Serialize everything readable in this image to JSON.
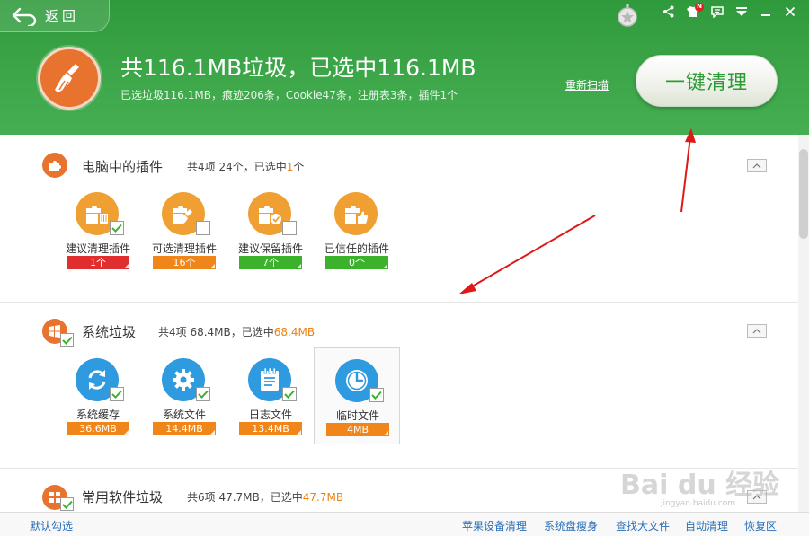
{
  "header": {
    "back_label": "返回",
    "summary_title": "共116.1MB垃圾，已选中116.1MB",
    "summary_sub": "已选垃圾116.1MB，痕迹206条，Cookie47条，注册表3条，插件1个",
    "rescan_label": "重新扫描",
    "clean_button_label": "一键清理",
    "badge": "N",
    "accent_color": "#3da74a"
  },
  "sections": [
    {
      "title": "电脑中的插件",
      "summary_prefix": "共4项 24个，已选中",
      "summary_highlight": "1",
      "summary_suffix": "个",
      "items": [
        {
          "label": "建议清理插件",
          "value": "1个",
          "color": "#e02e2e",
          "checked": true
        },
        {
          "label": "可选清理插件",
          "value": "16个",
          "color": "#f0861a",
          "checked": false
        },
        {
          "label": "建议保留插件",
          "value": "7个",
          "color": "#3cb22c",
          "checked": false
        },
        {
          "label": "已信任的插件",
          "value": "0个",
          "color": "#3cb22c",
          "checked": false
        }
      ]
    },
    {
      "title": "系统垃圾",
      "summary_prefix": "共4项 68.4MB，已选中",
      "summary_highlight": "68.4MB",
      "summary_suffix": "",
      "items": [
        {
          "label": "系统缓存",
          "value": "36.6MB",
          "color": "#f0861a",
          "checked": true
        },
        {
          "label": "系统文件",
          "value": "14.4MB",
          "color": "#f0861a",
          "checked": true
        },
        {
          "label": "日志文件",
          "value": "13.4MB",
          "color": "#f0861a",
          "checked": true
        },
        {
          "label": "临时文件",
          "value": "4MB",
          "color": "#f0861a",
          "checked": true
        }
      ]
    },
    {
      "title": "常用软件垃圾",
      "summary_prefix": "共6项 47.7MB，已选中",
      "summary_highlight": "47.7MB",
      "summary_suffix": ""
    }
  ],
  "footer": {
    "default_select": "默认勾选",
    "links": [
      "苹果设备清理",
      "系统盘瘦身",
      "查找大文件",
      "自动清理",
      "恢复区"
    ]
  },
  "watermark": {
    "text": "Bai du 经验",
    "url": "jingyan.baidu.com"
  }
}
